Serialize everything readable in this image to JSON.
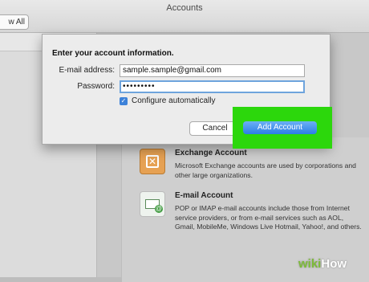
{
  "window": {
    "title": "Accounts",
    "show_all_label": "w All"
  },
  "sheet": {
    "heading": "Enter your account information.",
    "email_label": "E-mail address:",
    "email_value": "sample.sample@gmail.com",
    "password_label": "Password:",
    "password_value": "•••••••••",
    "configure_label": "Configure automatically",
    "configure_checked": true,
    "cancel_label": "Cancel",
    "add_label": "Add Account"
  },
  "account_types": [
    {
      "name": "Exchange Account",
      "description": "Microsoft Exchange accounts are used by corporations and other large organizations.",
      "icon": "exchange-icon"
    },
    {
      "name": "E-mail Account",
      "description": "POP or IMAP e-mail accounts include those from Internet service providers, or from e-mail services such as AOL, Gmail, MobileMe, Windows Live Hotmail, Yahoo!, and others.",
      "icon": "email-account-icon"
    }
  ],
  "watermark": {
    "prefix": "wiki",
    "suffix": "How"
  },
  "colors": {
    "highlight": "#2cd70c",
    "primary_button": "#2c7ee6"
  }
}
